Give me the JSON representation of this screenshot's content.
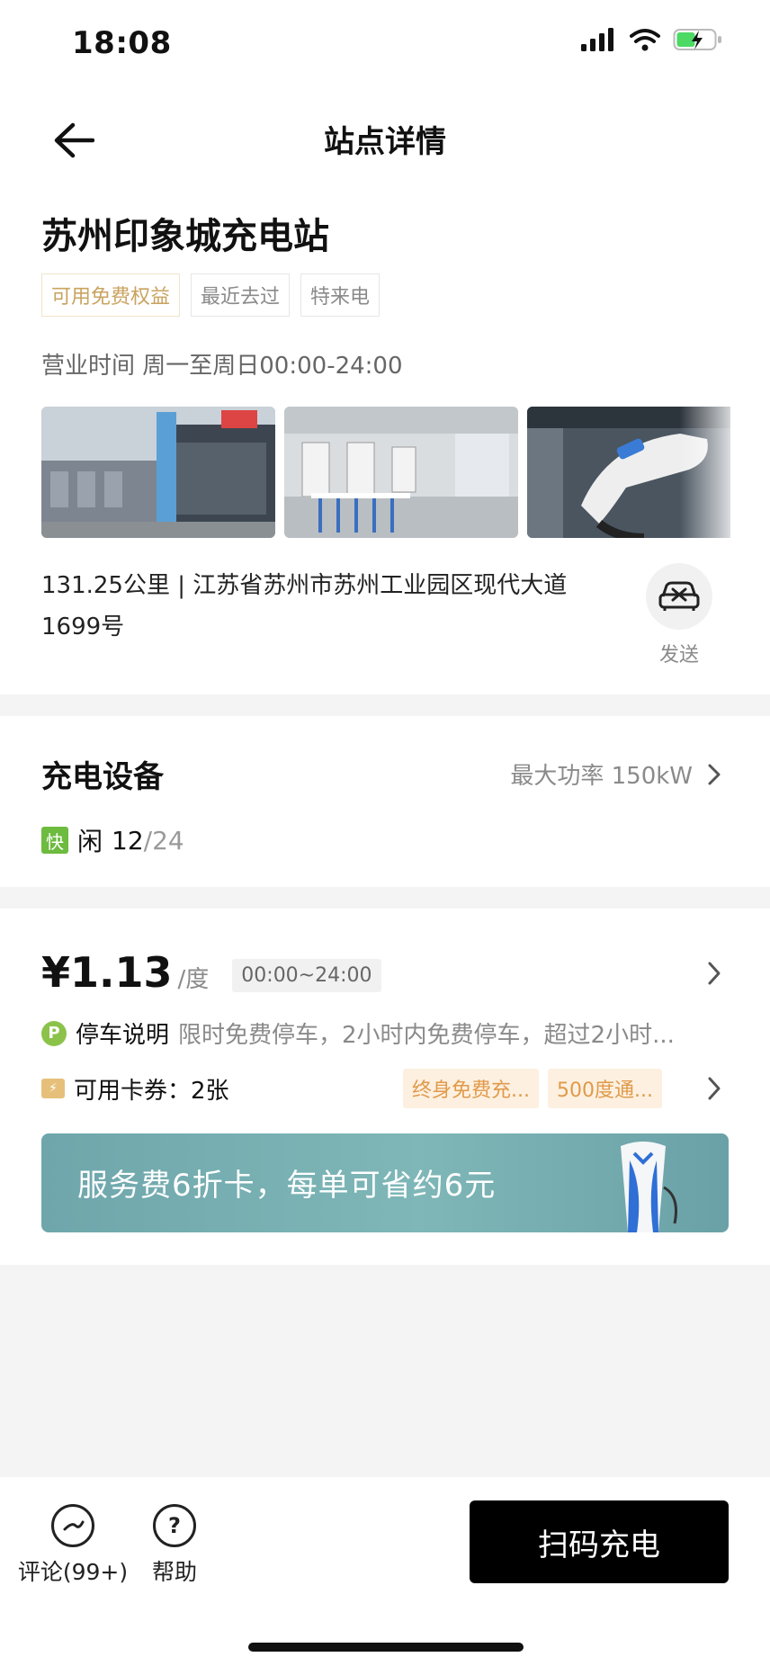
{
  "status": {
    "time": "18:08"
  },
  "nav": {
    "title": "站点详情"
  },
  "station": {
    "name": "苏州印象城充电站",
    "tags": [
      "可用免费权益",
      "最近去过",
      "特来电"
    ],
    "hours": "营业时间 周一至周日00:00-24:00",
    "address": "131.25公里 | 江苏省苏州市苏州工业园区现代大道1699号",
    "send_label": "发送"
  },
  "equipment": {
    "title": "充电设备",
    "max_power": "最大功率 150kW",
    "fast_label": "快",
    "idle_label": "闲",
    "idle_count": "12",
    "total": "/24"
  },
  "pricing": {
    "price": "¥1.13",
    "unit": "/度",
    "time_range": "00:00~24:00",
    "parking_icon": "P",
    "parking_title": "停车说明",
    "parking_detail": "限时免费停车，2小时内免费停车，超过2小时...",
    "coupon_title": "可用卡券：2张",
    "coupon_tags": [
      "终身免费充...",
      "500度通..."
    ],
    "banner_text": "服务费6折卡，每单可省约6元"
  },
  "bottom": {
    "comments_label": "评论(99+)",
    "help_label": "帮助",
    "scan_button": "扫码充电"
  }
}
